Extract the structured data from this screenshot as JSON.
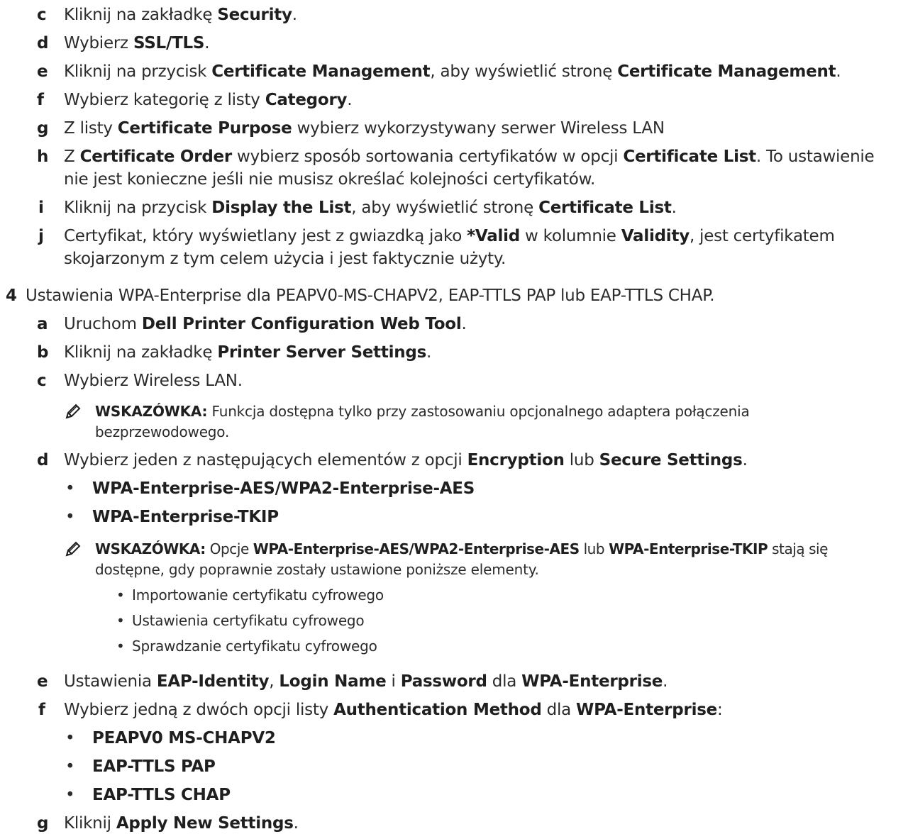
{
  "steps_prev": [
    {
      "marker": "c",
      "parts": [
        "Kliknij na zakładkę ",
        "Security",
        "."
      ]
    },
    {
      "marker": "d",
      "parts": [
        "Wybierz ",
        "SSL/TLS",
        "."
      ]
    },
    {
      "marker": "e",
      "parts": [
        "Kliknij na przycisk ",
        "Certificate Management",
        ", aby wyświetlić stronę ",
        "Certificate Management",
        "."
      ]
    },
    {
      "marker": "f",
      "parts": [
        "Wybierz kategorię z listy ",
        "Category",
        "."
      ]
    },
    {
      "marker": "g",
      "parts": [
        "Z listy ",
        "Certificate Purpose",
        " wybierz wykorzystywany serwer Wireless LAN"
      ]
    },
    {
      "marker": "h",
      "parts": [
        "Z ",
        "Certificate Order",
        " wybierz sposób sortowania certyfikatów w opcji ",
        "Certificate List",
        ". To ustawienie"
      ],
      "cont": "nie jest konieczne jeśli nie musisz określać kolejności certyfikatów."
    },
    {
      "marker": "i",
      "parts": [
        "Kliknij na przycisk ",
        "Display the List",
        ", aby wyświetlić stronę ",
        "Certificate List",
        "."
      ]
    },
    {
      "marker": "j",
      "parts": [
        "Certyfikat, który wyświetlany jest z gwiazdką jako ",
        "*Valid",
        " w kolumnie ",
        "Validity",
        ", jest certyfikatem"
      ],
      "cont": "skojarzonym z tym celem użycia i jest faktycznie użyty."
    }
  ],
  "step4": {
    "number": "4",
    "text": "Ustawienia WPA-Enterprise dla PEAPV0-MS-CHAPV2, EAP-TTLS PAP lub EAP-TTLS CHAP."
  },
  "step4_sub": {
    "a": {
      "marker": "a",
      "parts": [
        "Uruchom ",
        "Dell Printer Configuration Web Tool",
        "."
      ]
    },
    "b": {
      "marker": "b",
      "parts": [
        "Kliknij na zakładkę ",
        "Printer Server Settings",
        "."
      ]
    },
    "c": {
      "marker": "c",
      "parts": [
        "Wybierz Wireless LAN."
      ]
    },
    "note1": {
      "label": "WSKAZÓWKA:",
      "text": " Funkcja dostępna tylko przy zastosowaniu opcjonalnego adaptera połączenia",
      "cont": "bezprzewodowego."
    },
    "d": {
      "marker": "d",
      "parts": [
        "Wybierz jeden z następujących elementów z opcji ",
        "Encryption",
        " lub ",
        "Secure Settings",
        "."
      ]
    },
    "d_bullets": [
      "WPA-Enterprise-AES/WPA2-Enterprise-AES",
      "WPA-Enterprise-TKIP"
    ],
    "note2": {
      "label": "WSKAZÓWKA:",
      "parts": [
        " Opcje ",
        "WPA-Enterprise-AES/WPA2-Enterprise-AES",
        " lub ",
        "WPA-Enterprise-TKIP",
        " stają się"
      ],
      "cont": "dostępne, gdy poprawnie zostały ustawione poniższe elementy.",
      "bullets": [
        "Importowanie certyfikatu cyfrowego",
        "Ustawienia certyfikatu cyfrowego",
        "Sprawdzanie certyfikatu cyfrowego"
      ]
    },
    "e": {
      "marker": "e",
      "parts": [
        "Ustawienia ",
        "EAP-Identity",
        ", ",
        "Login Name",
        " i ",
        "Password",
        " dla ",
        "WPA-Enterprise",
        "."
      ]
    },
    "f": {
      "marker": "f",
      "parts": [
        "Wybierz jedną z dwóch opcji listy ",
        "Authentication Method",
        " dla ",
        "WPA-Enterprise",
        ":"
      ]
    },
    "f_bullets": [
      "PEAPV0 MS-CHAPV2",
      "EAP-TTLS PAP",
      "EAP-TTLS CHAP"
    ],
    "g": {
      "marker": "g",
      "parts": [
        "Kliknij ",
        "Apply New Settings",
        "."
      ]
    }
  },
  "bullet_char": "•",
  "icon": "pencil-note-icon"
}
